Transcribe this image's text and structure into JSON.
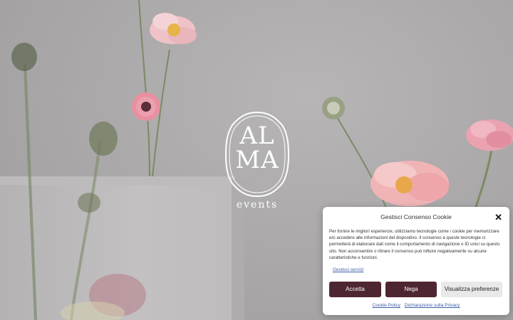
{
  "brand": {
    "logo_line1": "AL",
    "logo_line2": "MA",
    "sub": "events"
  },
  "cookie": {
    "title": "Gestisci Consenso Cookie",
    "body": "Per fornire le migliori esperienze, utilizziamo tecnologie come i cookie per memorizzare e/o accedere alle informazioni del dispositivo. Il consenso a queste tecnologie ci permetterà di elaborare dati come il comportamento di navigazione o ID unici su questo sito. Non acconsentire o ritirare il consenso può influire negativamente su alcune caratteristiche e funzioni.",
    "manage_link": "Gestisci servizi",
    "accept_label": "Accetta",
    "deny_label": "Nega",
    "prefs_label": "Visualizza preferenze",
    "policy_link": "Cookie Policy",
    "privacy_link": "Dichiarazione sulla Privacy",
    "close_icon": "close-icon",
    "accent_color": "#4e2632"
  }
}
